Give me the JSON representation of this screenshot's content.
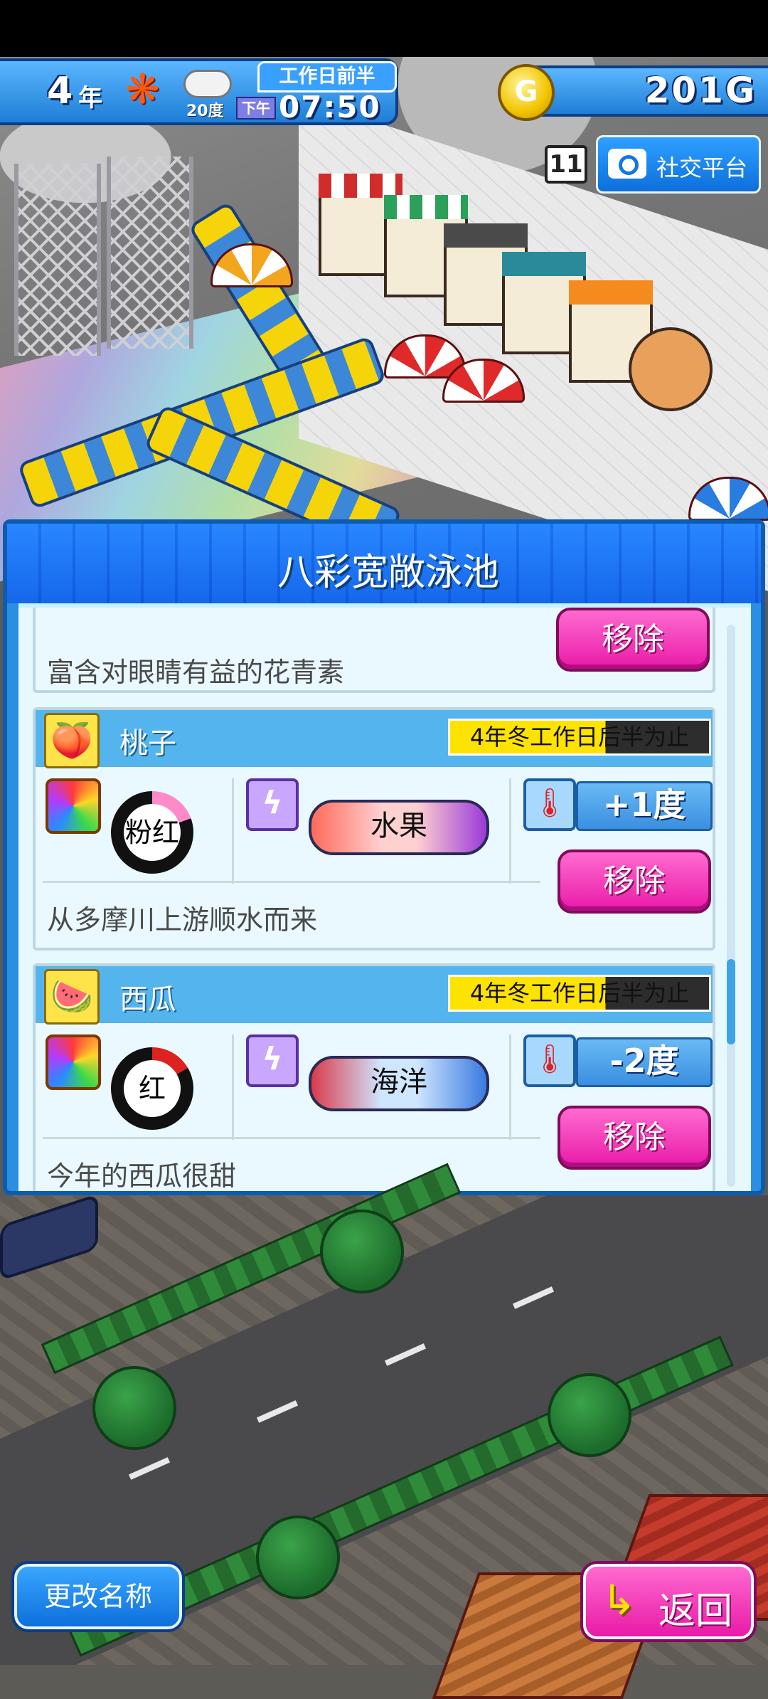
{
  "hud": {
    "year": "4",
    "year_unit": "年",
    "season_icon": "maple-leaf-icon",
    "weather_icon": "cloud-icon",
    "temperature": "20度",
    "period": "工作日前半",
    "ampm": "下午",
    "time": "07:50",
    "money": "201G",
    "coin_symbol": "G",
    "notif_count": "11",
    "social_label": "社交平台"
  },
  "panel": {
    "title": "八彩宽敞泳池",
    "cards": [
      {
        "desc": "富含对眼睛有益的花青素",
        "remove_label": "移除"
      },
      {
        "name": "桃子",
        "icon": "peach-icon",
        "expiry": "4年冬工作日后半为止",
        "color_label": "粉红",
        "tag_label": "水果",
        "temp": "+1度",
        "remove_label": "移除",
        "desc": "从多摩川上游顺水而来"
      },
      {
        "name": "西瓜",
        "icon": "watermelon-icon",
        "expiry": "4年冬工作日后半为止",
        "color_label": "红",
        "tag_label": "海洋",
        "temp": "-2度",
        "remove_label": "移除",
        "desc": "今年的西瓜很甜"
      }
    ]
  },
  "footer": {
    "rename_label": "更改名称",
    "back_label": "返回"
  },
  "colors": {
    "panel_blue": "#2a8fe0",
    "remove_pink": "#e91aa8",
    "expiry_yellow": "#ffe300",
    "hud_blue": "#1f7dd6"
  }
}
